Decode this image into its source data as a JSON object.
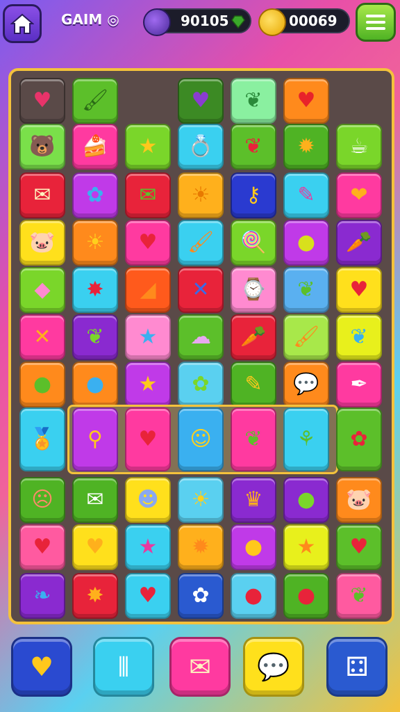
{
  "header": {
    "title": "GAIM ◎",
    "score": "90105",
    "coins": "00069",
    "home_icon": "home-icon",
    "menu_icon": "menu-icon"
  },
  "board": {
    "rows": [
      [
        {
          "icon": "heart",
          "bg": "transparent",
          "glyph": "♥",
          "color": "#e8336a"
        },
        {
          "icon": "paintbrush",
          "bg": "#5cbf2a",
          "glyph": "🖌",
          "color": "#2a6a16"
        },
        {
          "icon": "empty",
          "bg": "transparent",
          "glyph": "",
          "color": ""
        },
        {
          "icon": "heart",
          "bg": "#3c8a24",
          "glyph": "♥",
          "color": "#8a3cd0"
        },
        {
          "icon": "leaf",
          "bg": "#8af0a0",
          "glyph": "❦",
          "color": "#2a8a3a"
        },
        {
          "icon": "heart",
          "bg": "#ff8a1c",
          "glyph": "♥",
          "color": "#e8232a"
        },
        {
          "icon": "empty",
          "bg": "transparent",
          "glyph": "",
          "color": ""
        }
      ],
      [
        {
          "icon": "bear-face",
          "bg": "#7ae04a",
          "glyph": "🐻",
          "color": "#e85a1a"
        },
        {
          "icon": "cake",
          "bg": "#ff3aa0",
          "glyph": "🍰",
          "color": "#fff"
        },
        {
          "icon": "star",
          "bg": "#7ad62a",
          "glyph": "★",
          "color": "#ffc81c"
        },
        {
          "icon": "ring",
          "bg": "#3ad0f0",
          "glyph": "💍",
          "color": "#ffb01c"
        },
        {
          "icon": "leaf",
          "bg": "#5cbf2a",
          "glyph": "❦",
          "color": "#e8233a"
        },
        {
          "icon": "sun",
          "bg": "#4fb324",
          "glyph": "✹",
          "color": "#ffb01c"
        },
        {
          "icon": "cup",
          "bg": "#7ad62a",
          "glyph": "☕",
          "color": "#fff"
        }
      ],
      [
        {
          "icon": "envelope",
          "bg": "#e8233a",
          "glyph": "✉",
          "color": "#fff4c0"
        },
        {
          "icon": "flower",
          "bg": "#c03ae8",
          "glyph": "✿",
          "color": "#3ab0f0"
        },
        {
          "icon": "envelope",
          "bg": "#e8233a",
          "glyph": "✉",
          "color": "#5cbf2a"
        },
        {
          "icon": "sun-face",
          "bg": "#ffb01c",
          "glyph": "☀",
          "color": "#e87a00"
        },
        {
          "icon": "key",
          "bg": "#2a3ad0",
          "glyph": "⚷",
          "color": "#ffc81c"
        },
        {
          "icon": "wand",
          "bg": "#3ad0f0",
          "glyph": "✎",
          "color": "#e83aa0"
        },
        {
          "icon": "bean",
          "bg": "#ff3aa0",
          "glyph": "❤",
          "color": "#ffb01c"
        }
      ],
      [
        {
          "icon": "pig-face",
          "bg": "#ffe01c",
          "glyph": "🐷",
          "color": "#ff8ab0"
        },
        {
          "icon": "sun-face",
          "bg": "#ff8a1c",
          "glyph": "☀",
          "color": "#ffd01c"
        },
        {
          "icon": "heart",
          "bg": "#ff3aa0",
          "glyph": "♥",
          "color": "#e8233a"
        },
        {
          "icon": "paintbrush",
          "bg": "#3ad0f0",
          "glyph": "🖌",
          "color": "#ff8a1c"
        },
        {
          "icon": "lollipop",
          "bg": "#7ad62a",
          "glyph": "🍭",
          "color": "#ffb01c"
        },
        {
          "icon": "apple",
          "bg": "#c03ae8",
          "glyph": "●",
          "color": "#d8e01c"
        },
        {
          "icon": "carrot",
          "bg": "#8a2ad0",
          "glyph": "🥕",
          "color": "#ffc81c"
        }
      ],
      [
        {
          "icon": "diamond",
          "bg": "#7ad62a",
          "glyph": "◆",
          "color": "#ff8ad0"
        },
        {
          "icon": "star",
          "bg": "#3ad0f0",
          "glyph": "✸",
          "color": "#e8233a"
        },
        {
          "icon": "triangle",
          "bg": "#ff5a1c",
          "glyph": "◢",
          "color": "#ff8a1c"
        },
        {
          "icon": "cross",
          "bg": "#e8233a",
          "glyph": "✕",
          "color": "#3a6ae8"
        },
        {
          "icon": "clock",
          "bg": "#ff8ad0",
          "glyph": "⌚",
          "color": "#3ab0f0"
        },
        {
          "icon": "leaf",
          "bg": "#5ab0f0",
          "glyph": "❦",
          "color": "#5cbf2a"
        },
        {
          "icon": "heart-badge",
          "bg": "#ffe01c",
          "glyph": "♥",
          "color": "#e8233a"
        }
      ],
      [
        {
          "icon": "cross",
          "bg": "#ff3aa0",
          "glyph": "✕",
          "color": "#ffb01c"
        },
        {
          "icon": "leaf",
          "bg": "#8a2ad0",
          "glyph": "❦",
          "color": "#7ad62a"
        },
        {
          "icon": "star",
          "bg": "#ff8ad0",
          "glyph": "★",
          "color": "#3ab0f0"
        },
        {
          "icon": "cotton-candy",
          "bg": "#5cbf2a",
          "glyph": "☁",
          "color": "#e8a8f0"
        },
        {
          "icon": "carrot",
          "bg": "#e8233a",
          "glyph": "🥕",
          "color": "#ffb01c"
        },
        {
          "icon": "paintbrush",
          "bg": "#a8e84a",
          "glyph": "🖌",
          "color": "#ff8a1c"
        },
        {
          "icon": "tooth",
          "bg": "#e8f01c",
          "glyph": "❦",
          "color": "#3ab0f0"
        }
      ],
      [
        {
          "icon": "lollipop",
          "bg": "#ff8a1c",
          "glyph": "●",
          "color": "#5cbf2a"
        },
        {
          "icon": "lollipop",
          "bg": "#ff8a1c",
          "glyph": "●",
          "color": "#3ab0f0"
        },
        {
          "icon": "star",
          "bg": "#c03ae8",
          "glyph": "★",
          "color": "#ffc81c"
        },
        {
          "icon": "flower",
          "bg": "#5ad0f0",
          "glyph": "✿",
          "color": "#7ad62a"
        },
        {
          "icon": "pencil",
          "bg": "#4fb324",
          "glyph": "✎",
          "color": "#ffc81c"
        },
        {
          "icon": "speech",
          "bg": "#ff8a1c",
          "glyph": "💬",
          "color": "#ff8a1c"
        },
        {
          "icon": "pen",
          "bg": "#ff3aa0",
          "glyph": "✒",
          "color": "#fff"
        }
      ]
    ],
    "highlight_row": [
      {
        "icon": "medal-face",
        "bg": "#3ad0f0",
        "glyph": "🏅",
        "color": "#ffd01c"
      },
      {
        "icon": "ring",
        "bg": "#c03ae8",
        "glyph": "⚲",
        "color": "#ffc81c"
      },
      {
        "icon": "heart",
        "bg": "#ff3aa0",
        "glyph": "♥",
        "color": "#e8233a"
      },
      {
        "icon": "face",
        "bg": "#3ab0f0",
        "glyph": "☺",
        "color": "#ffd01c"
      },
      {
        "icon": "leaf",
        "bg": "#ff3aa0",
        "glyph": "❦",
        "color": "#5cbf2a"
      },
      {
        "icon": "flower-stem",
        "bg": "#3ad0f0",
        "glyph": "⚘",
        "color": "#5cbf2a"
      },
      {
        "icon": "leaf",
        "bg": "#5cbf2a",
        "glyph": "✿",
        "color": "#e8233a"
      }
    ],
    "rows_bottom": [
      [
        {
          "icon": "face",
          "bg": "#4fb324",
          "glyph": "☹",
          "color": "#ff8a6a"
        },
        {
          "icon": "envelope",
          "bg": "#4fb324",
          "glyph": "✉",
          "color": "#fff"
        },
        {
          "icon": "moon-face",
          "bg": "#ffe01c",
          "glyph": "☻",
          "color": "#8aa8f0"
        },
        {
          "icon": "sun-face",
          "bg": "#5ad0f0",
          "glyph": "☀",
          "color": "#ffd01c"
        },
        {
          "icon": "owl",
          "bg": "#8a2ad0",
          "glyph": "♛",
          "color": "#ffb01c"
        },
        {
          "icon": "apple",
          "bg": "#8a2ad0",
          "glyph": "●",
          "color": "#7ad62a"
        },
        {
          "icon": "pig-face",
          "bg": "#ff8a1c",
          "glyph": "🐷",
          "color": "#ff6ab0"
        }
      ],
      [
        {
          "icon": "heart-badge",
          "bg": "#ff5aa0",
          "glyph": "♥",
          "color": "#e8233a"
        },
        {
          "icon": "heart",
          "bg": "#ffe01c",
          "glyph": "♥",
          "color": "#ffb01c"
        },
        {
          "icon": "star",
          "bg": "#3ad0f0",
          "glyph": "★",
          "color": "#e83aa0"
        },
        {
          "icon": "cat-face",
          "bg": "#ffb01c",
          "glyph": "✹",
          "color": "#ff8a1c"
        },
        {
          "icon": "lollipop",
          "bg": "#c03ae8",
          "glyph": "●",
          "color": "#ffc81c"
        },
        {
          "icon": "star",
          "bg": "#e8f01c",
          "glyph": "★",
          "color": "#ff8a1c"
        },
        {
          "icon": "heart",
          "bg": "#5cbf2a",
          "glyph": "♥",
          "color": "#e8233a"
        }
      ],
      [
        {
          "icon": "feather",
          "bg": "#8a2ad0",
          "glyph": "❧",
          "color": "#3ab0f0"
        },
        {
          "icon": "leaf",
          "bg": "#e8233a",
          "glyph": "✸",
          "color": "#ffb01c"
        },
        {
          "icon": "heart",
          "bg": "#3ad0f0",
          "glyph": "♥",
          "color": "#e8233a"
        },
        {
          "icon": "flower",
          "bg": "#2a5ad0",
          "glyph": "✿",
          "color": "#fff"
        },
        {
          "icon": "lollipop",
          "bg": "#5ad0f0",
          "glyph": "●",
          "color": "#e8233a"
        },
        {
          "icon": "lollipop",
          "bg": "#4fb324",
          "glyph": "●",
          "color": "#e8233a"
        },
        {
          "icon": "leaf",
          "bg": "#ff5aa0",
          "glyph": "❦",
          "color": "#5cbf2a"
        }
      ]
    ]
  },
  "powerups": [
    {
      "name": "heart-powerup",
      "icon": "heart-icon",
      "bg": "#2a4ad0",
      "glyph": "♥",
      "color": "#ffc81c"
    },
    {
      "name": "crayons-powerup",
      "icon": "crayons-icon",
      "bg": "#3ad0f0",
      "glyph": "⦀",
      "color": "#fff"
    },
    {
      "name": "envelope-powerup",
      "icon": "envelope-icon",
      "bg": "#ff3aa0",
      "glyph": "✉",
      "color": "#fff4c0"
    },
    {
      "name": "speech-heart-powerup",
      "icon": "speech-heart-icon",
      "bg": "#ffe01c",
      "glyph": "💬",
      "color": "#fff"
    },
    {
      "name": "dice-powerup",
      "icon": "dice-icon",
      "bg": "#2a5ad0",
      "glyph": "⚃",
      "color": "#fff"
    }
  ]
}
